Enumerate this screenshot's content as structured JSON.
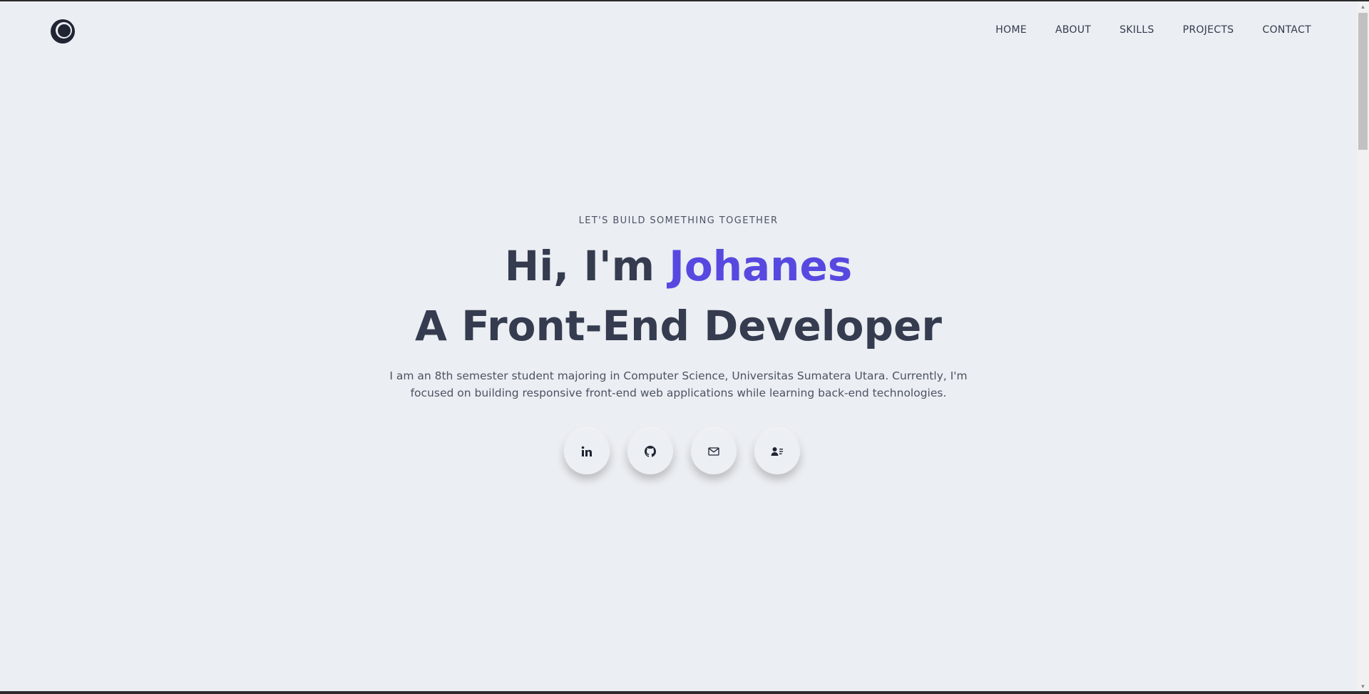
{
  "nav": {
    "items": [
      "HOME",
      "ABOUT",
      "SKILLS",
      "PROJECTS",
      "CONTACT"
    ]
  },
  "hero": {
    "eyebrow": "LET'S BUILD SOMETHING TOGETHER",
    "greeting_prefix": "Hi, I'm ",
    "name": "Johanes",
    "role": "A Front-End Developer",
    "description": "I am an 8th semester student majoring in Computer Science, Universitas Sumatera Utara. Currently, I'm focused on building responsive front-end web applications while learning back-end technologies."
  },
  "socials": [
    {
      "icon": "linkedin-icon"
    },
    {
      "icon": "github-icon"
    },
    {
      "icon": "mail-icon"
    },
    {
      "icon": "contact-card-icon"
    }
  ],
  "colors": {
    "background": "#ebeef2",
    "text": "#363c4f",
    "accent": "#5749e0"
  }
}
